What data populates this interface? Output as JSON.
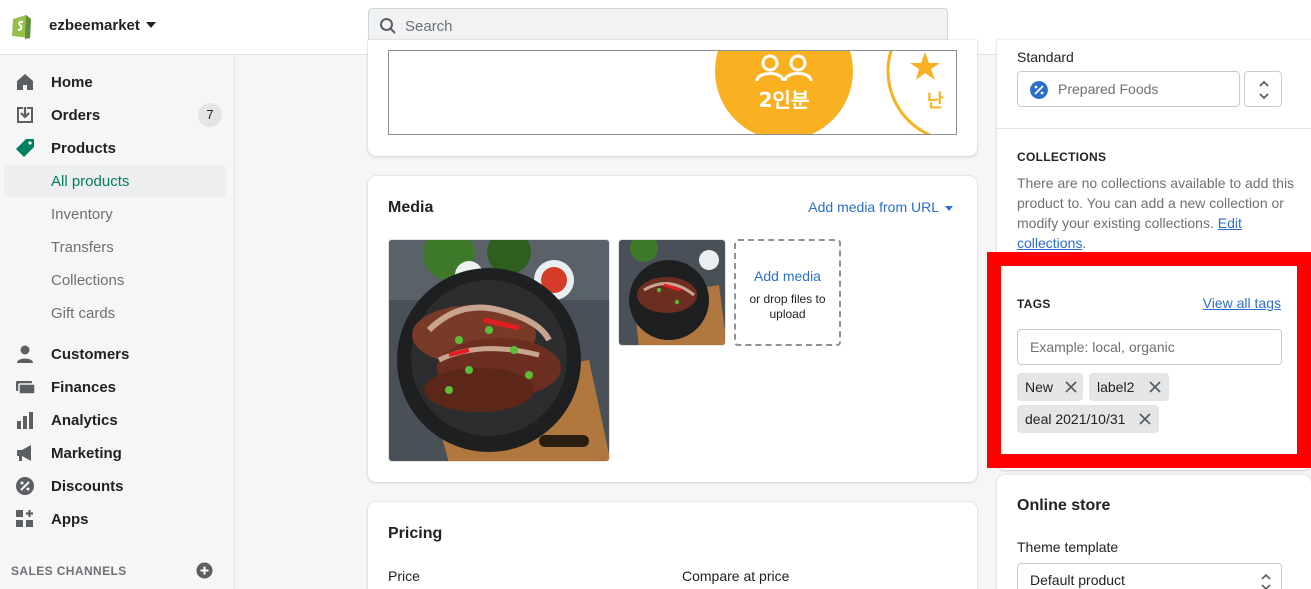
{
  "topbar": {
    "store_name": "ezbeemarket",
    "search_placeholder": "Search"
  },
  "sidebar": {
    "items": [
      {
        "label": "Home",
        "icon": "home-icon"
      },
      {
        "label": "Orders",
        "icon": "orders-icon",
        "badge": "7"
      },
      {
        "label": "Products",
        "icon": "tag-icon"
      }
    ],
    "product_subitems": [
      "All products",
      "Inventory",
      "Transfers",
      "Collections",
      "Gift cards"
    ],
    "lower_items": [
      {
        "label": "Customers",
        "icon": "person-icon"
      },
      {
        "label": "Finances",
        "icon": "finances-icon"
      },
      {
        "label": "Analytics",
        "icon": "bar-chart-icon"
      },
      {
        "label": "Marketing",
        "icon": "megaphone-icon"
      },
      {
        "label": "Discounts",
        "icon": "discount-icon"
      },
      {
        "label": "Apps",
        "icon": "apps-icon"
      }
    ],
    "sales_channels_label": "SALES CHANNELS"
  },
  "description_image": {
    "badge_text": "2인분",
    "badge_text_2": "난"
  },
  "media": {
    "title": "Media",
    "add_from_url": "Add media from URL",
    "add_media": "Add media",
    "drop_hint": "or drop files to upload"
  },
  "pricing": {
    "title": "Pricing",
    "price_label": "Price",
    "compare_label": "Compare at price"
  },
  "organization": {
    "standard_label": "Standard",
    "product_type": "Prepared Foods",
    "collections_heading": "COLLECTIONS",
    "collections_text": "There are no collections available to add this product to. You can add a new collection or modify your existing collections.",
    "edit_collections": "Edit collections",
    "tags_heading": "TAGS",
    "view_all_tags": "View all tags",
    "tag_placeholder": "Example: local, organic",
    "tags": [
      "New",
      "label2",
      "deal 2021/10/31"
    ]
  },
  "online_store": {
    "title": "Online store",
    "theme_label": "Theme template",
    "theme_value": "Default product"
  },
  "colors": {
    "brand_green": "#007f5f",
    "link_blue": "#2c6ecb",
    "highlight_red": "#ff0000"
  }
}
